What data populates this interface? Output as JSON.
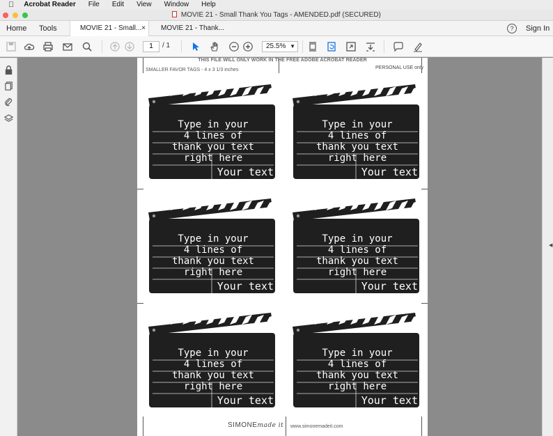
{
  "menubar": {
    "apple": "",
    "app": "Acrobat Reader",
    "items": [
      "File",
      "Edit",
      "View",
      "Window",
      "Help"
    ]
  },
  "window": {
    "title": "MOVIE 21 - Small Thank You Tags - AMENDED.pdf (SECURED)"
  },
  "nav": {
    "home": "Home",
    "tools": "Tools",
    "help_icon": "?",
    "sign_in": "Sign In"
  },
  "tabs": [
    {
      "label": "MOVIE 21 - Small...",
      "close": "×"
    },
    {
      "label": "MOVIE 21 - Thank..."
    }
  ],
  "toolbar": {
    "page_current": "1",
    "page_total": "/ 1",
    "zoom": "25.5%"
  },
  "document": {
    "notice": "THIS FILE WILL ONLY WORK IN THE FREE ADOBE ACROBAT READER",
    "subtitle": "SMALLER FAVOR TAGS - 4 x 3 1/3 inches",
    "personal": "PERSONAL USE only",
    "tags": [
      {
        "lines": "Type in your 4 lines of thank you text right here",
        "your_text": "Your text"
      },
      {
        "lines": "Type in your 4 lines of thank you text right here",
        "your_text": "Your text"
      },
      {
        "lines": "Type in your 4 lines of thank you text right here",
        "your_text": "Your text"
      },
      {
        "lines": "Type in your 4 lines of thank you text right here",
        "your_text": "Your text"
      },
      {
        "lines": "Type in your 4 lines of thank you text right here",
        "your_text": "Your text"
      },
      {
        "lines": "Type in your 4 lines of thank you text right here",
        "your_text": "Your text"
      }
    ],
    "tag_line_1": "Type in your",
    "tag_line_2": "4 lines of",
    "tag_line_3": "thank you text",
    "tag_line_4": "right here",
    "brand_main": "SIMONE",
    "brand_script": "made it",
    "url": "www.simonemadeit.com"
  },
  "colors": {
    "accent": "#1473e6",
    "clapper": "#1f1f1f",
    "viewer_bg": "#8b8b8b"
  }
}
